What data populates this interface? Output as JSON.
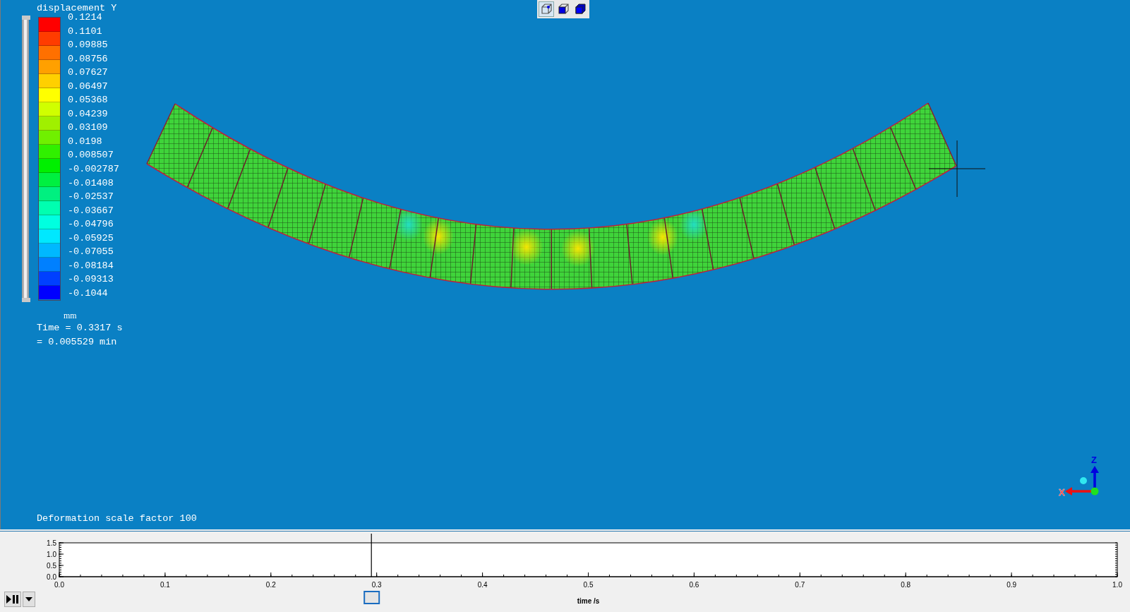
{
  "toolbar": {
    "buttons": [
      {
        "kind": "wire",
        "selected": true
      },
      {
        "kind": "front",
        "selected": false
      },
      {
        "kind": "solid",
        "selected": false
      }
    ]
  },
  "legend": {
    "title": "displacement Y",
    "unit": "mm",
    "time_s": "Time = 0.3317 s",
    "time_min": "= 0.005529 min",
    "labels": [
      "0.1214",
      "0.1101",
      "0.09885",
      "0.08756",
      "0.07627",
      "0.06497",
      "0.05368",
      "0.04239",
      "0.03109",
      "0.0198",
      "0.008507",
      "-0.002787",
      "-0.01408",
      "-0.02537",
      "-0.03667",
      "-0.04796",
      "-0.05925",
      "-0.07055",
      "-0.08184",
      "-0.09313",
      "-0.1044"
    ],
    "bands": [
      {
        "color": "#ff0000"
      },
      {
        "color": "#ff3c00"
      },
      {
        "color": "#ff7000"
      },
      {
        "color": "#ffa000"
      },
      {
        "color": "#ffd000"
      },
      {
        "color": "#ffff00"
      },
      {
        "color": "#d0ff00"
      },
      {
        "color": "#a0f000"
      },
      {
        "color": "#70f000"
      },
      {
        "color": "#30f000"
      },
      {
        "color": "#00f000"
      },
      {
        "color": "#00f040"
      },
      {
        "color": "#00f080"
      },
      {
        "color": "#00ffb0"
      },
      {
        "color": "#00ffe0"
      },
      {
        "color": "#00e8ff"
      },
      {
        "color": "#00b8ff"
      },
      {
        "color": "#0080ff"
      },
      {
        "color": "#0040ff"
      },
      {
        "color": "#0000ff"
      }
    ]
  },
  "triad": {
    "x_label": "X",
    "z_label": "Z"
  },
  "footer_note": "Deformation scale factor 100",
  "range_slider": {
    "level": 1
  },
  "timeline": {
    "slider": {
      "level": 0.295
    },
    "chart_data": {
      "type": "line",
      "xlabel": "time /s",
      "xlim": [
        0,
        1
      ],
      "ylim": [
        0,
        1.5
      ],
      "xticks": [
        {
          "value": 0,
          "label": "0.0"
        },
        {
          "value": 0.1,
          "label": "0.1"
        },
        {
          "value": 0.2,
          "label": "0.2"
        },
        {
          "value": 0.3,
          "label": "0.3"
        },
        {
          "value": 0.4,
          "label": "0.4"
        },
        {
          "value": 0.5,
          "label": "0.5"
        },
        {
          "value": 0.6,
          "label": "0.6"
        },
        {
          "value": 0.7,
          "label": "0.7"
        },
        {
          "value": 0.8,
          "label": "0.8"
        },
        {
          "value": 0.9,
          "label": "0.9"
        },
        {
          "value": 1,
          "label": "1.0"
        }
      ],
      "yticks": [
        {
          "value": 0,
          "label": "0.0"
        },
        {
          "value": 0.5,
          "label": "0.5"
        },
        {
          "value": 1,
          "label": "1.0"
        },
        {
          "value": 1.5,
          "label": "1.5"
        }
      ],
      "ref_lines": [
        {
          "axis": "x",
          "value": 0.295
        }
      ]
    }
  }
}
